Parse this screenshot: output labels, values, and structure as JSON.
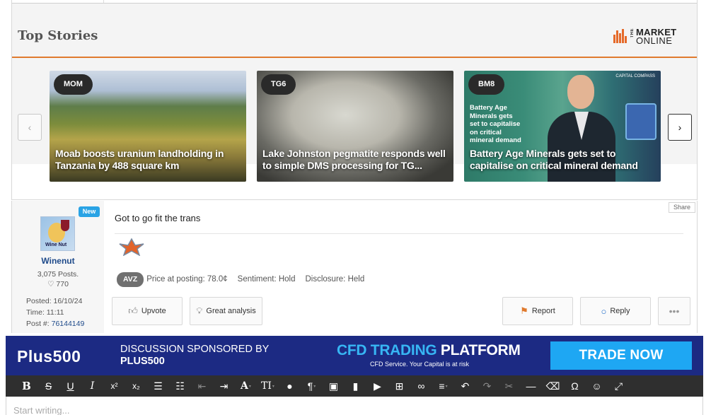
{
  "top_stories": {
    "title": "Top Stories",
    "logo": {
      "line1": "MARKET",
      "line2": "ONLINE",
      "prefix": "THE"
    },
    "prev_arrow": "‹",
    "next_arrow": "›",
    "cards": [
      {
        "code": "MOM",
        "headline": "Moab boosts uranium landholding in Tanzania by 488 square km"
      },
      {
        "code": "TG6",
        "headline": "Lake Johnston pegmatite responds well to simple DMS processing for TG..."
      },
      {
        "code": "BM8",
        "headline": "Battery Age Minerals gets set to capitalise on critical mineral demand",
        "image_caption": [
          "Battery Age",
          "Minerals gets",
          "set to capitalise",
          "on critical",
          "mineral demand"
        ],
        "image_logo": "CAPITAL COMPASS"
      }
    ]
  },
  "post": {
    "new_badge": "New",
    "author": "Winenut",
    "avatar_label": "Wine Nut",
    "posts": "3,075 Posts.",
    "likes": "770",
    "posted_label": "Posted:",
    "posted_value": "16/10/24",
    "time_label": "Time:",
    "time_value": "11:11",
    "post_no_label": "Post #:",
    "post_no_value": "76144149",
    "share": "Share",
    "text": "Got to go fit the trans",
    "stock_code": "AVZ",
    "price": "Price at posting: 78.0¢",
    "sentiment": "Sentiment: Hold",
    "disclosure": "Disclosure: Held",
    "actions": {
      "upvote": "Upvote",
      "great_analysis": "Great analysis",
      "report": "Report",
      "reply": "Reply",
      "more": "•••"
    }
  },
  "sponsor": {
    "brand": "Plus500",
    "line1": "DISCUSSION SPONSORED BY",
    "line2": "PLUS500",
    "headline_accent": "CFD TRADING",
    "headline_rest": " PLATFORM",
    "subline": "CFD Service. Your Capital is at risk",
    "cta": "TRADE NOW"
  },
  "editor": {
    "placeholder": "Start writing...",
    "toolbar": [
      "bold",
      "strikethrough",
      "underline",
      "italic",
      "superscript",
      "subscript",
      "bullet-list",
      "numbered-list",
      "outdent",
      "indent",
      "font-family",
      "text-size",
      "text-color",
      "paragraph",
      "image",
      "file",
      "video",
      "table",
      "link",
      "align",
      "undo",
      "redo",
      "cut",
      "horizontal-rule",
      "clear-format",
      "special-char",
      "emoji",
      "fullscreen"
    ]
  },
  "colors": {
    "accent_orange": "#e07a2e",
    "link_blue": "#1e4a8a",
    "sponsor_navy": "#1c2a83",
    "sponsor_cta": "#1ea7f3"
  }
}
